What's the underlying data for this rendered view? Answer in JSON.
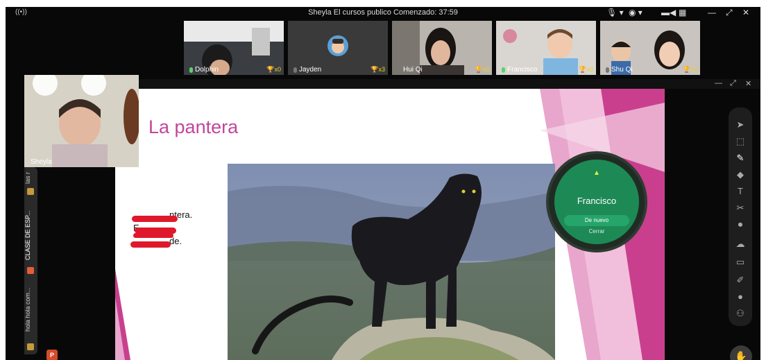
{
  "window": {
    "title": "Sheyla El cursos publico  Comenzado: 37:59",
    "live_icon": "((•))",
    "mic_label": "🎙 ▾",
    "cam_label": "◉ ▾",
    "controls": [
      "▬◀",
      "▦",
      "—",
      "⤢",
      "✕"
    ]
  },
  "participants": [
    {
      "name": "Dolphin",
      "stars": "x0"
    },
    {
      "name": "Jayden",
      "stars": "x3"
    },
    {
      "name": "Hui Qi",
      "stars": "x0"
    },
    {
      "name": "Francisco",
      "stars": "x0"
    },
    {
      "name": "Shu Qi",
      "stars": "x2"
    }
  ],
  "teacher": {
    "name": "Sheyla"
  },
  "stage_controls": [
    "—",
    "⤢",
    "✕"
  ],
  "slide": {
    "title": "La pantera",
    "lines": [
      "Es la pantera.",
      "Es negra.",
      "Es grande."
    ],
    "visible_tails": [
      "ntera.",
      "",
      "de."
    ]
  },
  "side_tabs": [
    {
      "label": "las r",
      "color": "#c59a3a"
    },
    {
      "label": "CLASE DE ESP...",
      "color": "#e35d3a"
    },
    {
      "label": "hola hola com...",
      "color": "#c59a3a"
    }
  ],
  "toolbar": {
    "tools": [
      {
        "name": "pointer",
        "glyph": "➤"
      },
      {
        "name": "select",
        "glyph": "⬚"
      },
      {
        "name": "pen",
        "glyph": "✎"
      },
      {
        "name": "eraser",
        "glyph": "◆"
      },
      {
        "name": "text",
        "glyph": "T"
      },
      {
        "name": "scissors",
        "glyph": "✂"
      },
      {
        "name": "record",
        "glyph": "⏺"
      },
      {
        "name": "cloud",
        "glyph": "☁"
      },
      {
        "name": "toolbox",
        "glyph": "▭"
      },
      {
        "name": "edit",
        "glyph": "✐"
      },
      {
        "name": "chat",
        "glyph": "●"
      },
      {
        "name": "users",
        "glyph": "⚇"
      }
    ],
    "active_tool": "pen"
  },
  "picker": {
    "name": "Francisco",
    "again_label": "De nuevo",
    "close_label": "Cerrar"
  },
  "colors": {
    "slide_title": "#c2459b",
    "accent_pink": "#c93f8e",
    "picker_green": "#1d8a56",
    "star_yellow": "#e8d41b"
  }
}
